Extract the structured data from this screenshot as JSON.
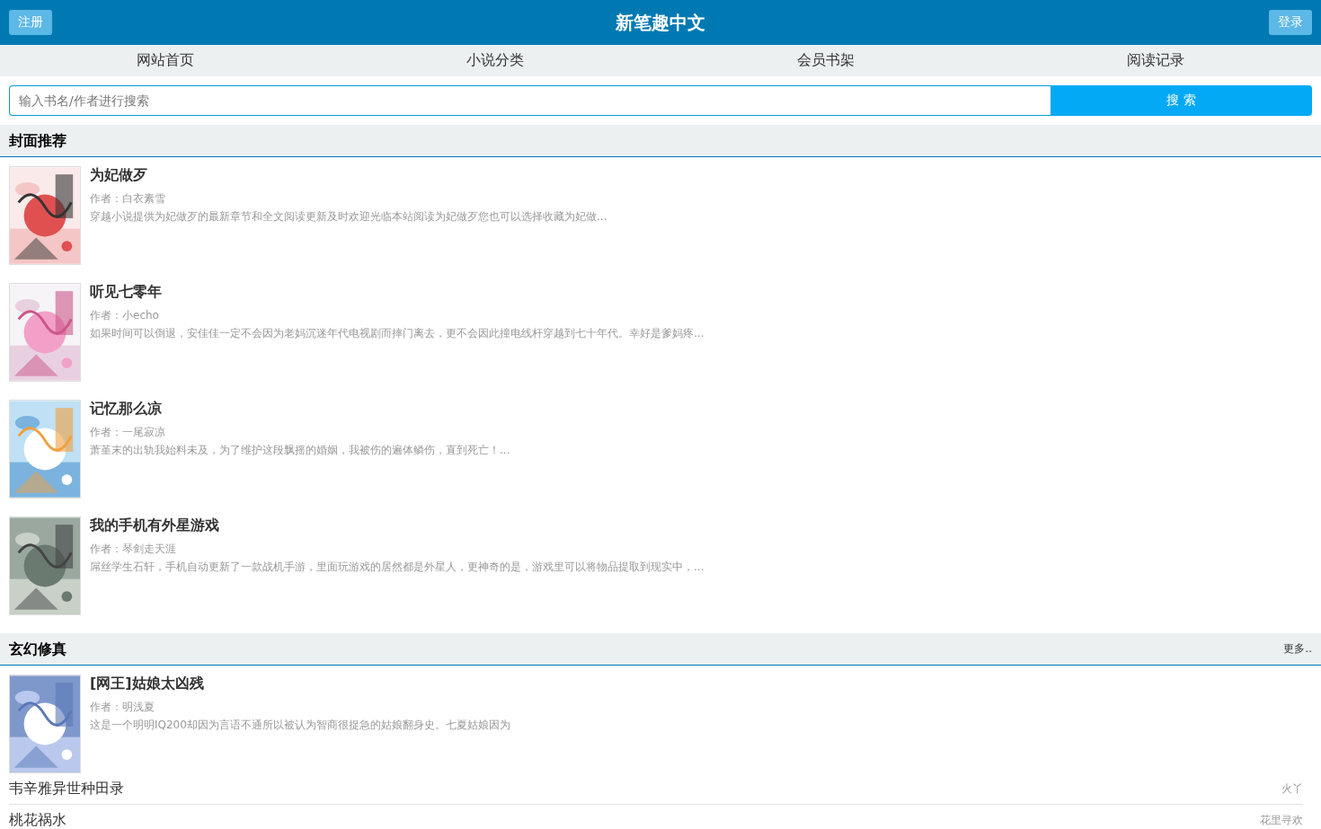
{
  "header": {
    "title": "新笔趣中文",
    "left_button": "注册",
    "right_button": "登录"
  },
  "nav": [
    {
      "label": "网站首页"
    },
    {
      "label": "小说分类"
    },
    {
      "label": "会员书架"
    },
    {
      "label": "阅读记录"
    }
  ],
  "search": {
    "placeholder": "输入书名/作者进行搜索",
    "button": "搜 索"
  },
  "sections": [
    {
      "title": "封面推荐",
      "books": [
        {
          "title": "为妃做歹",
          "author": "作者：白衣素雪",
          "summary": "穿越小说提供为妃做歹的最新章节和全文阅读更新及时欢迎光临本站阅读为妃做歹您也可以选择收藏为妃做..."
        },
        {
          "title": "听见七零年",
          "author": "作者：小echo",
          "summary": "如果时间可以倒退，安佳佳一定不会因为老妈沉迷年代电视剧而摔门离去，更不会因此撞电线杆穿越到七十年代。幸好是爹妈疼..."
        },
        {
          "title": "记忆那么凉",
          "author": "作者：一尾寂凉",
          "summary": "萧堇末的出轨我始料未及，为了维护这段飘摇的婚姻，我被伤的遍体鳞伤，直到死亡！..."
        },
        {
          "title": "我的手机有外星游戏",
          "author": "作者：琴剑走天涯",
          "summary": "屌丝学生石轩，手机自动更新了一款战机手游，里面玩游戏的居然都是外星人，更神奇的是，游戏里可以将物品提取到现实中，..."
        }
      ]
    },
    {
      "title": "玄幻修真",
      "more": "更多..",
      "books": [
        {
          "title": "[网王]姑娘太凶残",
          "author": "作者：明浅夏",
          "summary": "这是一个明明IQ200却因为言语不通所以被认为智商很捉急的姑娘翻身史。七夏姑娘因为"
        }
      ],
      "list": [
        {
          "title": "韦辛雅异世种田录",
          "author": "火丫"
        },
        {
          "title": "桃花祸水",
          "author": "花里寻欢"
        }
      ]
    }
  ]
}
